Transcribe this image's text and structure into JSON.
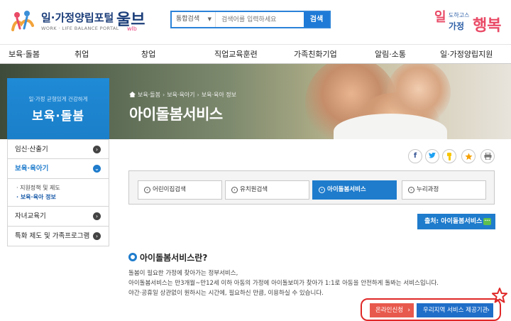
{
  "header": {
    "logo_title": "일·가정양립포털",
    "logo_brand": "울브",
    "logo_brand_sub": "wlb",
    "logo_subtitle": "WORK · LIFE BALANCE PORTAL",
    "slogan": {
      "s1": "일",
      "s2": "도하고스",
      "s3": "가정",
      "s4": "행복"
    }
  },
  "search": {
    "select_value": "통합검색",
    "placeholder": "검색어를 입력하세요",
    "button_label": "검색",
    "accent": "#1e7ad6"
  },
  "gnb": {
    "items": [
      {
        "label": "보육·돌봄"
      },
      {
        "label": "취업"
      },
      {
        "label": "창업"
      },
      {
        "label": "직업교육훈련"
      },
      {
        "label": "가족친화기업"
      },
      {
        "label": "알림·소통"
      },
      {
        "label": "일·가정양립지원"
      }
    ]
  },
  "hero": {
    "breadcrumb": [
      "보육·돌봄",
      "보육·육아기",
      "보육·육아 정보"
    ],
    "page_title": "아이돌봄서비스"
  },
  "lnb": {
    "card_subtitle": "일·가정 균형있게 건강하게",
    "card_title": "보육·돌봄",
    "items": [
      {
        "label": "임신·산출기"
      },
      {
        "label": "보육·육아기"
      },
      {
        "label": "자녀교육기"
      },
      {
        "label": "특화 제도 및 가족프로그램"
      }
    ],
    "subitems": [
      {
        "label": "· 지원정책 및 제도"
      },
      {
        "label": "· 보육·육아 정보"
      }
    ]
  },
  "share": {
    "icons": [
      "facebook-icon",
      "twitter-icon",
      "kakaostory-icon",
      "favorite-star-icon",
      "print-icon"
    ]
  },
  "tabs": [
    {
      "label": "어린이집검색",
      "active": false
    },
    {
      "label": "유치원검색",
      "active": false
    },
    {
      "label": "아이돌봄서비스",
      "active": true
    },
    {
      "label": "누리과정",
      "active": false
    }
  ],
  "source_button": {
    "label": "출처: 아이돌봄서비스",
    "badge": "···"
  },
  "section": {
    "title": "아이돌봄서비스란?",
    "lines": [
      "돌봄이 필요한 가정에 찾아가는 정부서비스,",
      "아이돌봄서비스는 만3개월~만12세 이하 아동의 가정에 아이돌보미가 찾아가 1:1로 아동을 안전하게 돌봐는 서비스입니다.",
      "야간·공휴일 상관없이 원하시는 시간에, 필요하신 만큼, 이용하실 수 있습니다."
    ]
  },
  "actions": {
    "apply_label": "온라인신청",
    "region_label": "우리지역 서비스 제공기관",
    "arrow": "›"
  }
}
